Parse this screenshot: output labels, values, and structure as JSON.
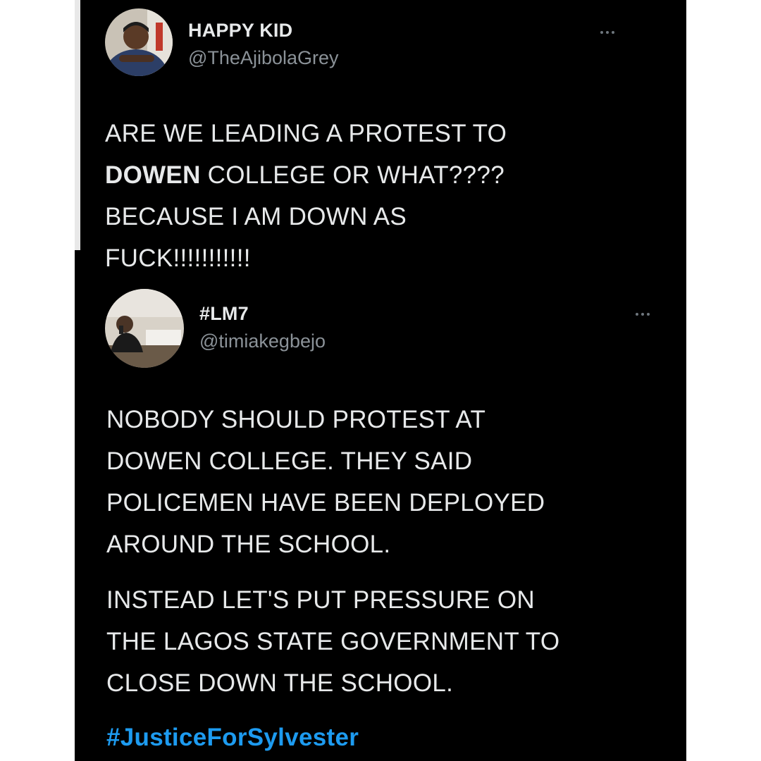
{
  "tweet1": {
    "display_name": "HAPPY KID",
    "handle": "@TheAjibolaGrey",
    "more_icon": "more-horizontal-icon",
    "text_line1": "ARE WE LEADING A PROTEST TO",
    "text_bold": "DOWEN",
    "text_line2_rest": " COLLEGE OR WHAT????",
    "text_line3": "BECAUSE I AM DOWN AS",
    "text_line4": "FUCK!!!!!!!!!!!"
  },
  "tweet2": {
    "display_name": "#LM7",
    "handle": "@timiakegbejo",
    "more_icon": "more-horizontal-icon",
    "para1_line1": "NOBODY SHOULD PROTEST AT",
    "para1_line2": "DOWEN COLLEGE. THEY SAID",
    "para1_line3": "POLICEMEN HAVE BEEN DEPLOYED",
    "para1_line4": "AROUND THE SCHOOL.",
    "para2_line1": "INSTEAD LET'S PUT PRESSURE ON",
    "para2_line2": "THE LAGOS STATE GOVERNMENT TO",
    "para2_line3": "CLOSE DOWN THE SCHOOL.",
    "hashtag": "#JusticeForSylvester"
  },
  "colors": {
    "background": "#000000",
    "text": "#e7e9ea",
    "handle": "#8b9298",
    "hashtag": "#1d9bf0"
  }
}
